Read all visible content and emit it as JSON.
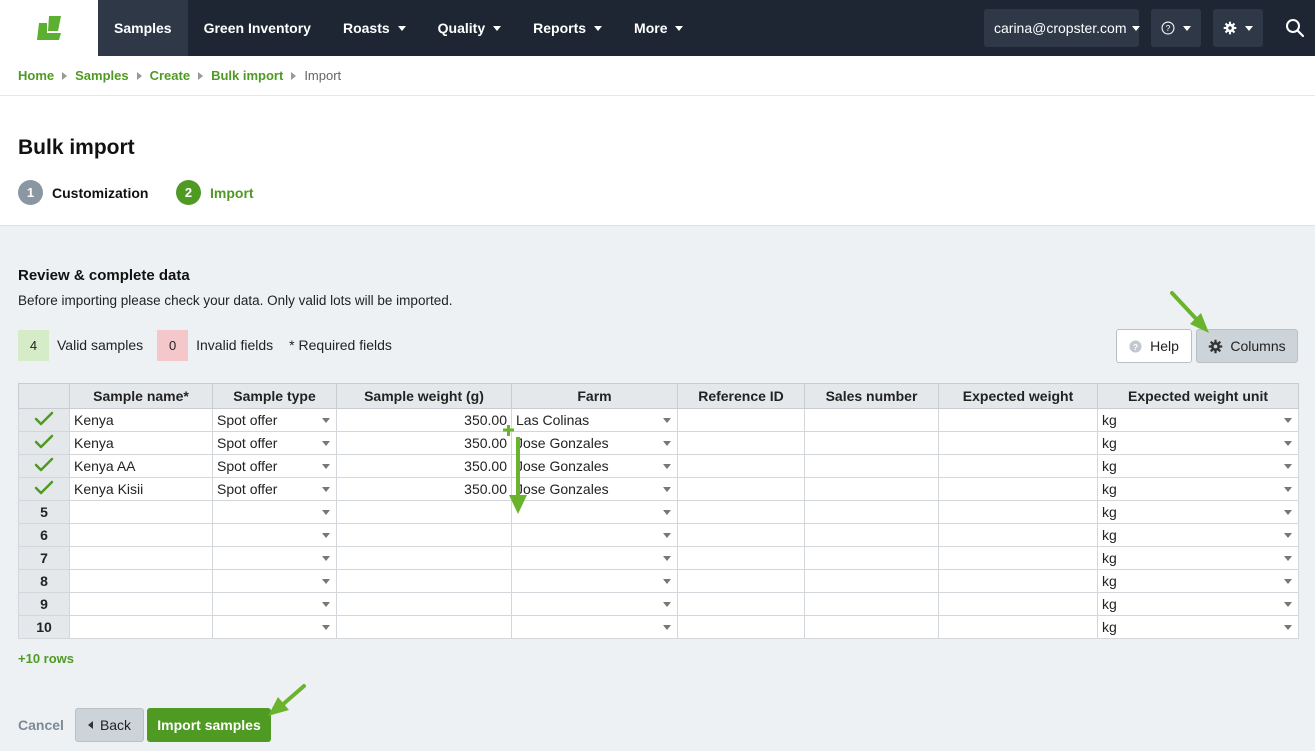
{
  "nav": {
    "items": [
      {
        "label": "Samples",
        "active": true,
        "dropdown": false
      },
      {
        "label": "Green Inventory",
        "active": false,
        "dropdown": false
      },
      {
        "label": "Roasts",
        "active": false,
        "dropdown": true
      },
      {
        "label": "Quality",
        "active": false,
        "dropdown": true
      },
      {
        "label": "Reports",
        "active": false,
        "dropdown": true
      },
      {
        "label": "More",
        "active": false,
        "dropdown": true
      }
    ],
    "user_email": "carina@cropster.com",
    "help_icon": "question-circle-icon",
    "settings_icon": "gear-icon",
    "search_icon": "search-icon"
  },
  "breadcrumb": {
    "items": [
      "Home",
      "Samples",
      "Create",
      "Bulk import"
    ],
    "current": "Import"
  },
  "header": {
    "title": "Bulk import",
    "steps": [
      {
        "num": "1",
        "label": "Customization",
        "active": false
      },
      {
        "num": "2",
        "label": "Import",
        "active": true
      }
    ]
  },
  "review": {
    "title": "Review & complete data",
    "description": "Before importing please check your data. Only valid lots will be imported.",
    "valid_count": "4",
    "valid_label": "Valid samples",
    "invalid_count": "0",
    "invalid_label": "Invalid fields",
    "required_note": "* Required fields",
    "help_label": "Help",
    "columns_label": "Columns"
  },
  "table": {
    "headers": [
      "Sample name*",
      "Sample type",
      "Sample weight (g)",
      "Farm",
      "Reference ID",
      "Sales number",
      "Expected weight",
      "Expected weight unit"
    ],
    "rows": [
      {
        "marker": "check",
        "name": "Kenya",
        "type": "Spot offer",
        "weight": "350.00",
        "farm": "Las Colinas",
        "unit": "kg"
      },
      {
        "marker": "check",
        "name": "Kenya",
        "type": "Spot offer",
        "weight": "350.00",
        "farm": "Jose Gonzales",
        "unit": "kg"
      },
      {
        "marker": "check",
        "name": "Kenya AA",
        "type": "Spot offer",
        "weight": "350.00",
        "farm": "Jose Gonzales",
        "unit": "kg"
      },
      {
        "marker": "check",
        "name": "Kenya Kisii",
        "type": "Spot offer",
        "weight": "350.00",
        "farm": "Jose Gonzales",
        "unit": "kg"
      },
      {
        "marker": "5",
        "name": "",
        "type": "",
        "weight": "",
        "farm": "",
        "unit": "kg"
      },
      {
        "marker": "6",
        "name": "",
        "type": "",
        "weight": "",
        "farm": "",
        "unit": "kg"
      },
      {
        "marker": "7",
        "name": "",
        "type": "",
        "weight": "",
        "farm": "",
        "unit": "kg"
      },
      {
        "marker": "8",
        "name": "",
        "type": "",
        "weight": "",
        "farm": "",
        "unit": "kg"
      },
      {
        "marker": "9",
        "name": "",
        "type": "",
        "weight": "",
        "farm": "",
        "unit": "kg"
      },
      {
        "marker": "10",
        "name": "",
        "type": "",
        "weight": "",
        "farm": "",
        "unit": "kg"
      }
    ],
    "add_rows_label": "+10 rows"
  },
  "footer": {
    "cancel_label": "Cancel",
    "back_label": "Back",
    "import_label": "Import samples"
  },
  "colors": {
    "brand_green": "#4f9a23",
    "nav_dark": "#1e2633",
    "valid_bg": "#d6ecc8",
    "invalid_bg": "#f4c7cb",
    "arrow_green": "#6ab42d"
  }
}
